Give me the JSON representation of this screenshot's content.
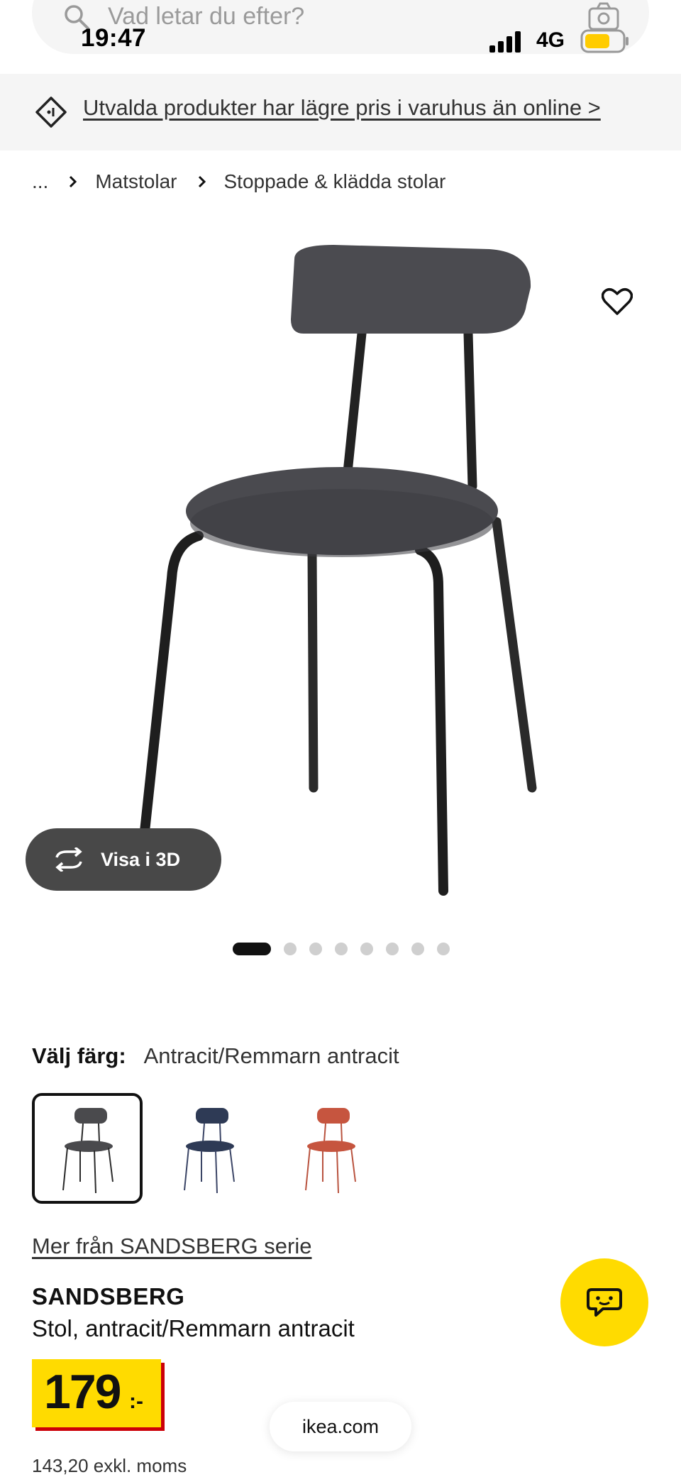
{
  "status_bar": {
    "time": "19:47",
    "network": "4G",
    "battery_color": "#ffcc00"
  },
  "search": {
    "placeholder": "Vad letar du efter?",
    "icon": "search-icon",
    "camera_icon": "camera-icon"
  },
  "promo": {
    "text": "Utvalda produkter har lägre pris i varuhus än online >",
    "icon": "price-tag-icon"
  },
  "breadcrumb": {
    "items": [
      "...",
      "Matstolar",
      "Stoppade & klädda stolar"
    ]
  },
  "gallery": {
    "view_3d_label": "Visa i 3D",
    "image_count": 8,
    "active_index": 0
  },
  "color": {
    "label": "Välj färg:",
    "selected": "Antracit/Remmarn antracit",
    "swatches": [
      {
        "name": "antracit",
        "seat": "#4a4a4d",
        "frame": "#2a2a2a"
      },
      {
        "name": "blue",
        "seat": "#2e3a55",
        "frame": "#3b4566"
      },
      {
        "name": "red",
        "seat": "#c6553f",
        "frame": "#b9533f"
      }
    ]
  },
  "product": {
    "series_link": "Mer från SANDSBERG serie",
    "name": "SANDSBERG",
    "description": "Stol, antracit/Remmarn antracit",
    "price_integer": "179",
    "price_suffix": ":-",
    "price_ex_vat": "143,20 exkl. moms"
  },
  "browser": {
    "url": "ikea.com"
  },
  "colors": {
    "ikea_yellow": "#ffdb00",
    "ikea_red": "#cc0008"
  }
}
